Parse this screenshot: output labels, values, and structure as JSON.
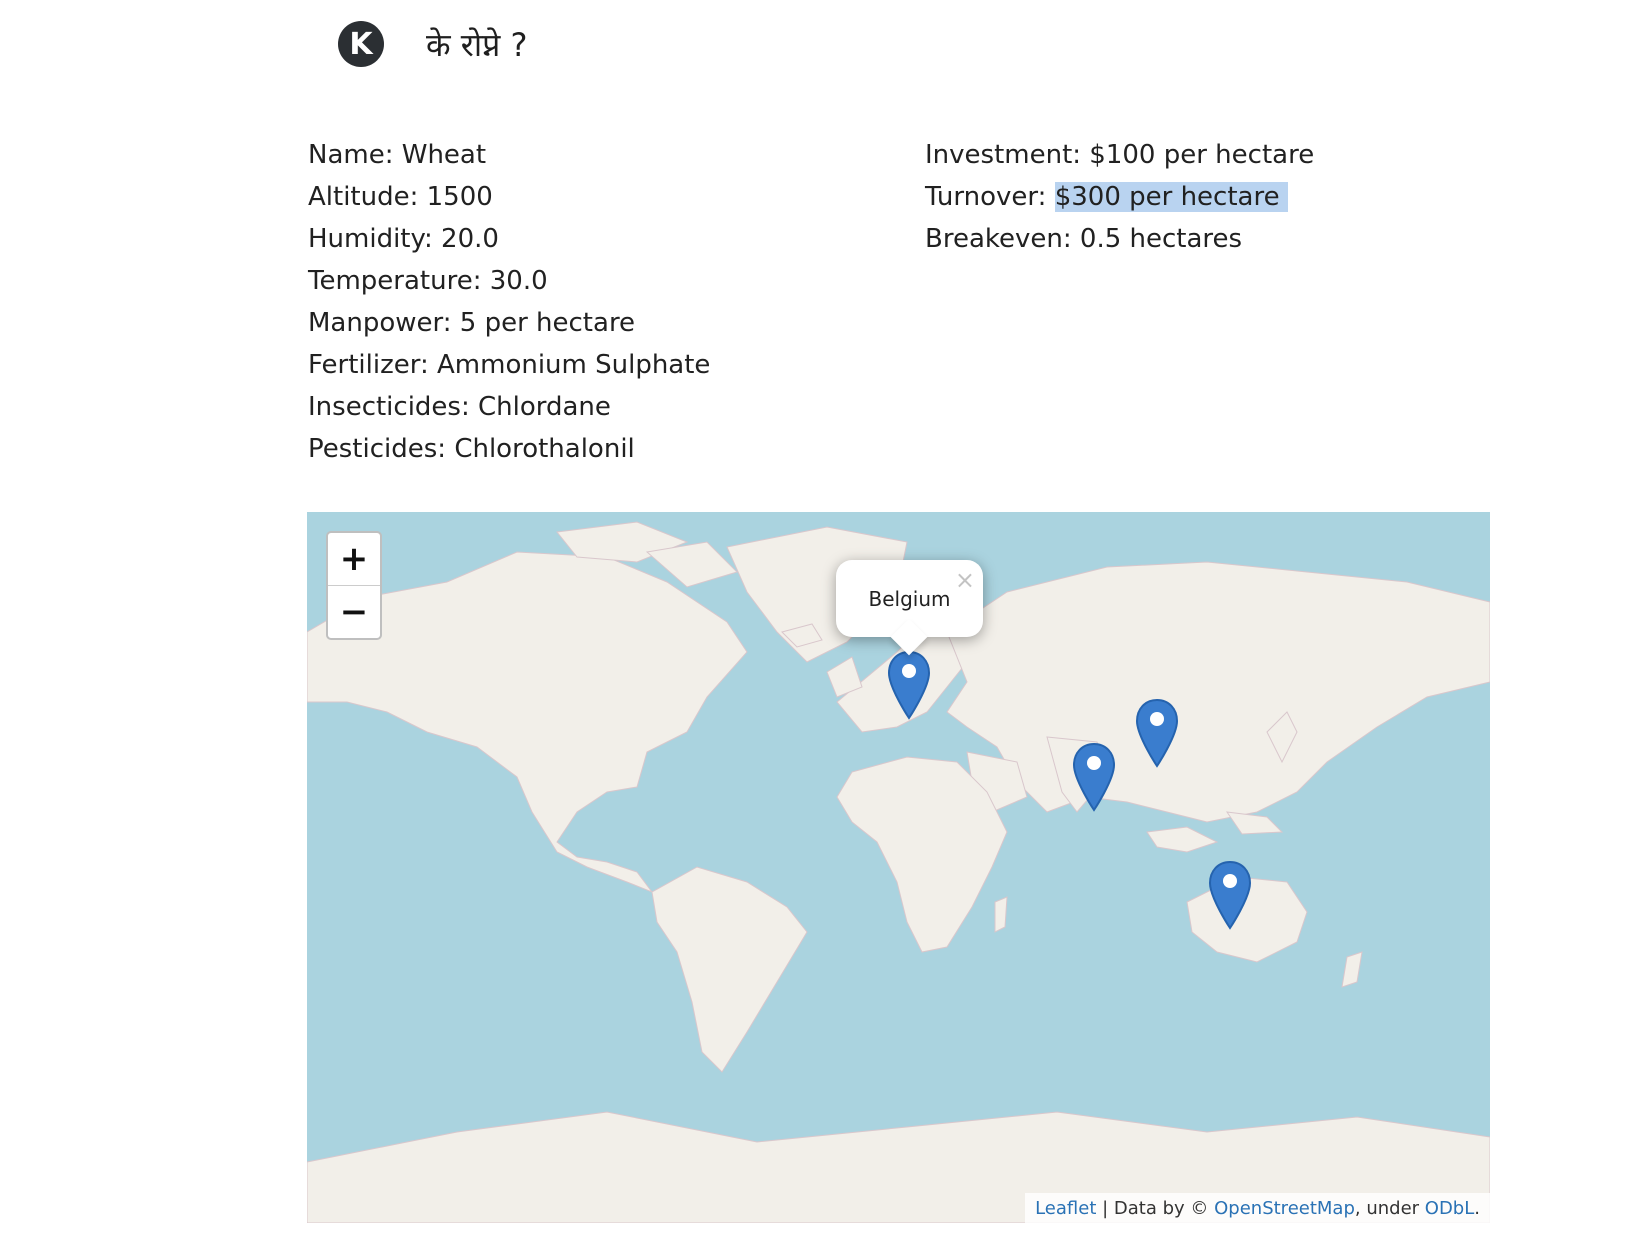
{
  "header": {
    "logo_letter": "K",
    "title": "के रोप्ने ?"
  },
  "crop": {
    "left": [
      {
        "label": "Name",
        "value": "Wheat"
      },
      {
        "label": "Altitude",
        "value": "1500"
      },
      {
        "label": "Humidity",
        "value": "20.0"
      },
      {
        "label": "Temperature",
        "value": "30.0"
      },
      {
        "label": "Manpower",
        "value": "5 per hectare"
      },
      {
        "label": "Fertilizer",
        "value": "Ammonium Sulphate"
      },
      {
        "label": "Insecticides",
        "value": "Chlordane"
      },
      {
        "label": "Pesticides",
        "value": "Chlorothalonil"
      }
    ],
    "right": [
      {
        "label": "Investment",
        "value": "$100 per hectare"
      },
      {
        "label": "Turnover",
        "value": "$300 per hectare"
      },
      {
        "label": "Breakeven",
        "value": "0.5 hectares"
      }
    ]
  },
  "map": {
    "zoom_in_label": "+",
    "zoom_out_label": "−",
    "popup": {
      "text": "Belgium",
      "close_label": "×"
    },
    "marker_color": "#3a7dce",
    "attribution": {
      "leaflet": "Leaflet",
      "sep": " | Data by © ",
      "osm": "OpenStreetMap",
      "under": ", under ",
      "odbl": "ODbL",
      "end": "."
    }
  },
  "colors": {
    "water": "#aad3df",
    "land": "#f2efe9",
    "highlight": "#b9d3f0",
    "link": "#2a72b5"
  }
}
